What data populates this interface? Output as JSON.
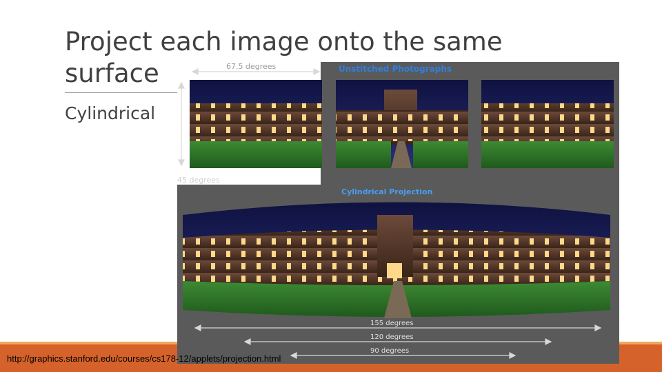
{
  "slide": {
    "title": "Project each image onto the same surface",
    "bullet": "Cylindrical",
    "source_url": "http://graphics.stanford.edu/courses/cs178-12/applets/projection.html"
  },
  "figure": {
    "top_label": "Unstitched Photographs",
    "bottom_label": "Cylindrical Projection",
    "horizontal_fov": "67.5 degrees",
    "vertical_fov": "45 degrees",
    "span_labels": [
      "155 degrees",
      "120 degrees",
      "90 degrees"
    ]
  },
  "colors": {
    "accent": "#d5622a",
    "accent_light": "#f2a65e",
    "label_blue": "#2f7fe0",
    "panel_bg": "#5a5a5a",
    "sky": "#1b1f5c",
    "lawn": "#2f7a2a"
  }
}
